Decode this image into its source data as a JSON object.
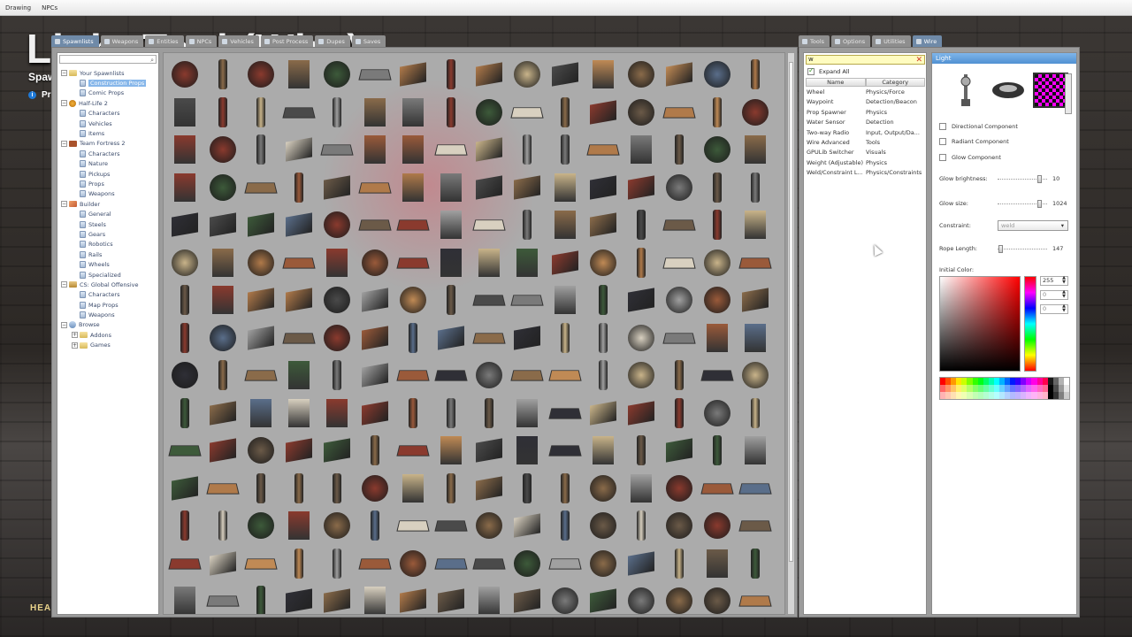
{
  "menubar": {
    "items": [
      "Drawing",
      "NPCs"
    ]
  },
  "background": {
    "title": "Light Tool (Wire)",
    "subtitle": "Spaw",
    "info": "Pr",
    "hud": "HEA"
  },
  "spawn_tabs": [
    {
      "label": "Spawnlists",
      "active": true
    },
    {
      "label": "Weapons",
      "active": false
    },
    {
      "label": "Entities",
      "active": false
    },
    {
      "label": "NPCs",
      "active": false
    },
    {
      "label": "Vehicles",
      "active": false
    },
    {
      "label": "Post Process",
      "active": false
    },
    {
      "label": "Dupes",
      "active": false
    },
    {
      "label": "Saves",
      "active": false
    }
  ],
  "tree": [
    {
      "label": "Your Spawnlists",
      "depth": 0,
      "exp": "−",
      "icon": "folder"
    },
    {
      "label": "Construction Props",
      "depth": 1,
      "exp": "",
      "icon": "page",
      "selected": true
    },
    {
      "label": "Comic Props",
      "depth": 1,
      "exp": "",
      "icon": "page"
    },
    {
      "label": "Half-Life 2",
      "depth": 0,
      "exp": "−",
      "icon": "hl2"
    },
    {
      "label": "Characters",
      "depth": 1,
      "exp": "",
      "icon": "page"
    },
    {
      "label": "Vehicles",
      "depth": 1,
      "exp": "",
      "icon": "page"
    },
    {
      "label": "Items",
      "depth": 1,
      "exp": "",
      "icon": "page"
    },
    {
      "label": "Team Fortress 2",
      "depth": 0,
      "exp": "−",
      "icon": "tf2"
    },
    {
      "label": "Characters",
      "depth": 1,
      "exp": "",
      "icon": "page"
    },
    {
      "label": "Nature",
      "depth": 1,
      "exp": "",
      "icon": "page"
    },
    {
      "label": "Pickups",
      "depth": 1,
      "exp": "",
      "icon": "page"
    },
    {
      "label": "Props",
      "depth": 1,
      "exp": "",
      "icon": "page"
    },
    {
      "label": "Weapons",
      "depth": 1,
      "exp": "",
      "icon": "page"
    },
    {
      "label": "Builder",
      "depth": 0,
      "exp": "−",
      "icon": "builder"
    },
    {
      "label": "General",
      "depth": 1,
      "exp": "",
      "icon": "page"
    },
    {
      "label": "Steels",
      "depth": 1,
      "exp": "",
      "icon": "page"
    },
    {
      "label": "Gears",
      "depth": 1,
      "exp": "",
      "icon": "page"
    },
    {
      "label": "Robotics",
      "depth": 1,
      "exp": "",
      "icon": "page"
    },
    {
      "label": "Rails",
      "depth": 1,
      "exp": "",
      "icon": "page"
    },
    {
      "label": "Wheels",
      "depth": 1,
      "exp": "",
      "icon": "page"
    },
    {
      "label": "Specialized",
      "depth": 1,
      "exp": "",
      "icon": "page"
    },
    {
      "label": "CS: Global Offensive",
      "depth": 0,
      "exp": "−",
      "icon": "csgo"
    },
    {
      "label": "Characters",
      "depth": 1,
      "exp": "",
      "icon": "page"
    },
    {
      "label": "Map Props",
      "depth": 1,
      "exp": "",
      "icon": "page"
    },
    {
      "label": "Weapons",
      "depth": 1,
      "exp": "",
      "icon": "page"
    },
    {
      "label": "Browse",
      "depth": 0,
      "exp": "−",
      "icon": "browse"
    },
    {
      "label": "Addons",
      "depth": 1,
      "exp": "+",
      "icon": "folder"
    },
    {
      "label": "Games",
      "depth": 1,
      "exp": "+",
      "icon": "folder"
    }
  ],
  "tool_tabs": [
    {
      "label": "Tools",
      "active": false
    },
    {
      "label": "Options",
      "active": false
    },
    {
      "label": "Utilities",
      "active": false
    },
    {
      "label": "Wire",
      "active": true
    }
  ],
  "tool_list": {
    "search_value": "w",
    "expand_all": "Expand All",
    "col_name": "Name",
    "col_category": "Category",
    "rows": [
      {
        "name": "Wheel",
        "category": "Physics/Force"
      },
      {
        "name": "Waypoint",
        "category": "Detection/Beacon"
      },
      {
        "name": "Prop Spawner",
        "category": "Physics"
      },
      {
        "name": "Water Sensor",
        "category": "Detection"
      },
      {
        "name": "Two-way Radio",
        "category": "Input, Output/Da..."
      },
      {
        "name": "Wire Advanced",
        "category": "Tools"
      },
      {
        "name": "GPULib Switcher",
        "category": "Visuals"
      },
      {
        "name": "Weight (Adjustable)",
        "category": "Physics"
      },
      {
        "name": "Weld/Constraint L...",
        "category": "Physics/Constraints"
      }
    ]
  },
  "light_panel": {
    "title": "Light",
    "checks": [
      {
        "label": "Directional Component",
        "checked": false
      },
      {
        "label": "Radiant Component",
        "checked": false
      },
      {
        "label": "Glow Component",
        "checked": false
      }
    ],
    "glow_brightness": {
      "label": "Glow brightness:",
      "value": "10",
      "fraction": 0.9
    },
    "glow_size": {
      "label": "Glow size:",
      "value": "1024",
      "fraction": 0.9
    },
    "constraint": {
      "label": "Constraint:",
      "value": "weld"
    },
    "rope_length": {
      "label": "Rope Length:",
      "value": "147",
      "fraction": 0.05
    },
    "initial_color": "Initial Color:",
    "r": "255",
    "g": "0",
    "b": "0"
  }
}
